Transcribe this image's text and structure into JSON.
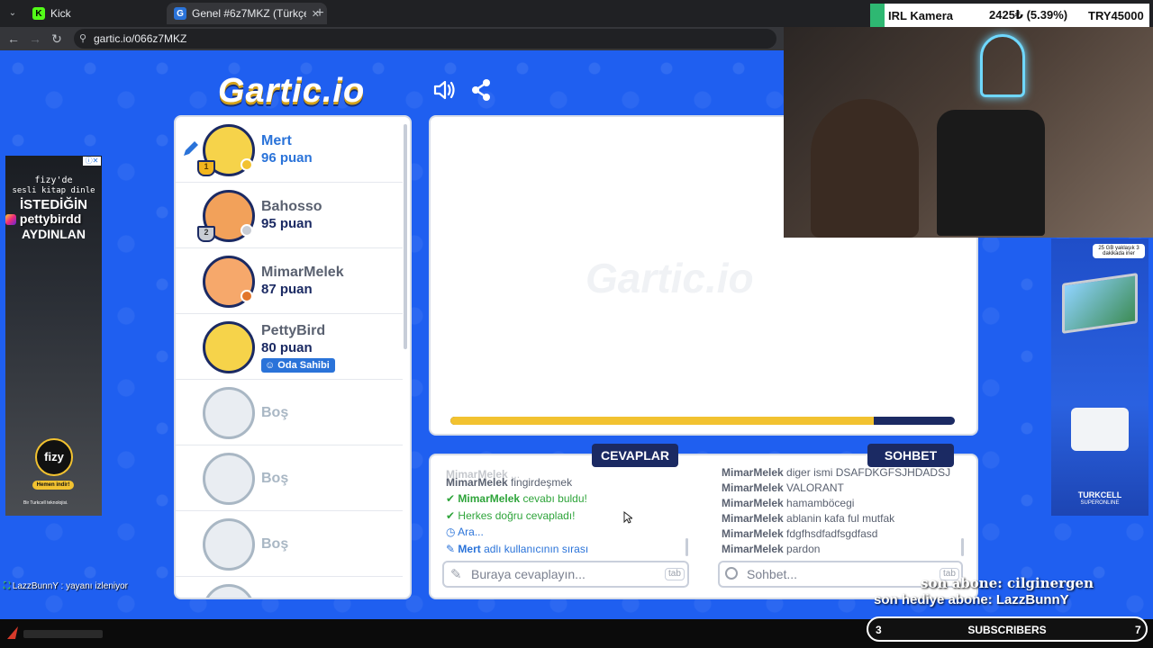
{
  "browser": {
    "tabs": [
      {
        "title": "Kick"
      },
      {
        "title": "Genel #6z7MKZ (Türkçe) - Gartic"
      }
    ],
    "url": "gartic.io/066z7MKZ"
  },
  "stream_overlay": {
    "ticker_name": "IRL Kamera",
    "ticker_value": "2425₺ (5.39%)",
    "ticker_goal": "TRY45000",
    "instagram_handle": "pettybirdd",
    "viewer_note": "LazzBunnY : yayanı izleniyor",
    "last_sub": "son abone: cilginergen",
    "last_gift_sub": "son hediye abone: LazzBunnY",
    "subs_left": "3",
    "subs_label": "SUBSCRIBERS",
    "subs_right": "7"
  },
  "game": {
    "logo": "Gartic.io",
    "players": [
      {
        "name": "Mert",
        "score": "96 puan",
        "rank": "1",
        "avatar_color": "#f6d34a",
        "dot": "#f2c230",
        "name_color": "#2a73d9"
      },
      {
        "name": "Bahosso",
        "score": "95 puan",
        "rank": "2",
        "avatar_color": "#f2a15a",
        "dot": "#c9cdd4",
        "name_color": "#5a6170"
      },
      {
        "name": "MimarMelek",
        "score": "87 puan",
        "avatar_color": "#f6a86b",
        "dot": "#e2762c",
        "name_color": "#5a6170"
      },
      {
        "name": "PettyBird",
        "score": "80 puan",
        "badge": "Oda Sahibi",
        "avatar_color": "#f6d34a",
        "name_color": "#5a6170"
      }
    ],
    "empty_slots": [
      "Boş",
      "Boş",
      "Boş"
    ],
    "timer_fraction": 0.84,
    "canvas_watermark": "Gartic.io",
    "answers_tab": "CEVAPLAR",
    "chat_tab": "SOHBET",
    "answers": [
      {
        "user": "MimarMelek",
        "text": "fingirdeşmek",
        "kind": "normal"
      },
      {
        "user": "MimarMelek",
        "text": "cevabı buldu!",
        "kind": "ok"
      },
      {
        "user": "",
        "text": "Herkes doğru cevapladı!",
        "kind": "ok"
      },
      {
        "user": "",
        "text": "Ara...",
        "kind": "info"
      },
      {
        "user": "Mert",
        "text": "adlı kullanıcının sırası",
        "kind": "info"
      }
    ],
    "chat": [
      {
        "user": "MimarMelek",
        "text": "diger ismi DSAFDKGFSJHDADSJ"
      },
      {
        "user": "MimarMelek",
        "text": "VALORANT"
      },
      {
        "user": "MimarMelek",
        "text": "hamamböcegi"
      },
      {
        "user": "MimarMelek",
        "text": "ablanin kafa ful mutfak"
      },
      {
        "user": "MimarMelek",
        "text": "fdgfhsdfadfsgdfasd"
      },
      {
        "user": "MimarMelek",
        "text": "pardon"
      }
    ],
    "answer_placeholder": "Buraya cevaplayın...",
    "chat_placeholder": "Sohbet...",
    "tab_key": "tab"
  },
  "ads": {
    "left_lines": [
      "fizy'de",
      "sesli kitap dinle",
      "İSTEDİĞİN",
      "AYDINLAN"
    ],
    "left_brand": "fizy",
    "left_cta": "Hemen indir!",
    "left_footer": "Bir Turkcell teknolojisi.",
    "right_top": "25 GB yaklaşık 3 dakikada iner",
    "right_brand": "TURKCELL",
    "right_sub": "SUPERONLINE"
  }
}
